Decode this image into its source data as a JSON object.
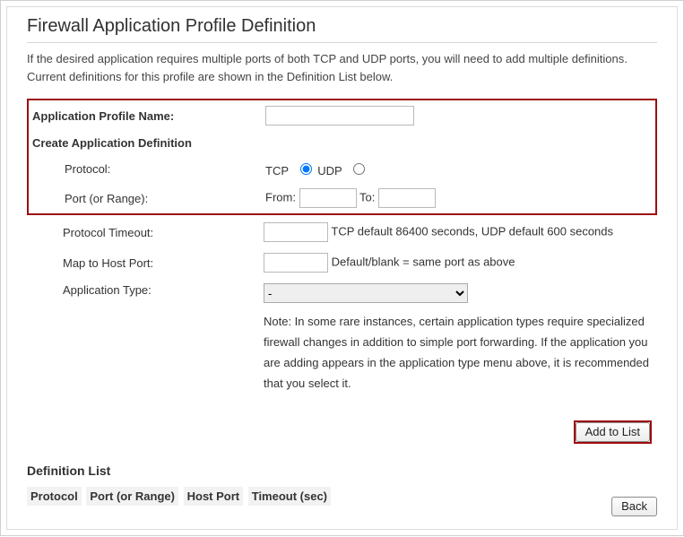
{
  "page_title": "Firewall Application Profile Definition",
  "intro_text": "If the desired application requires multiple ports of both TCP and UDP ports, you will need to add multiple definitions. Current definitions for this profile are shown in the Definition List below.",
  "form": {
    "app_profile_name_label": "Application Profile Name:",
    "app_profile_name_value": "",
    "create_def_heading": "Create Application Definition",
    "protocol_label": "Protocol:",
    "protocol_tcp_label": "TCP",
    "protocol_tcp_checked": true,
    "protocol_udp_label": "UDP",
    "protocol_udp_checked": false,
    "port_range_label": "Port (or Range):",
    "port_from_label": "From:",
    "port_from_value": "",
    "port_to_label": "To:",
    "port_to_value": "",
    "protocol_timeout_label": "Protocol Timeout:",
    "protocol_timeout_value": "",
    "protocol_timeout_hint": "TCP default 86400 seconds, UDP default 600 seconds",
    "map_to_host_port_label": "Map to Host Port:",
    "map_to_host_port_value": "",
    "map_to_host_port_hint": "Default/blank = same port as above",
    "app_type_label": "Application Type:",
    "app_type_value": "-",
    "app_type_options": [
      "-"
    ],
    "note_text": "Note: In some rare instances, certain application types require specialized firewall changes in addition to simple port forwarding. If the application you are adding appears in the application type menu above, it is recommended that you select it."
  },
  "buttons": {
    "add_to_list": "Add to List",
    "back": "Back"
  },
  "definition_list": {
    "heading": "Definition List",
    "columns": {
      "protocol": "Protocol",
      "port_range": "Port (or Range)",
      "host_port": "Host Port",
      "timeout": "Timeout (sec)"
    }
  }
}
